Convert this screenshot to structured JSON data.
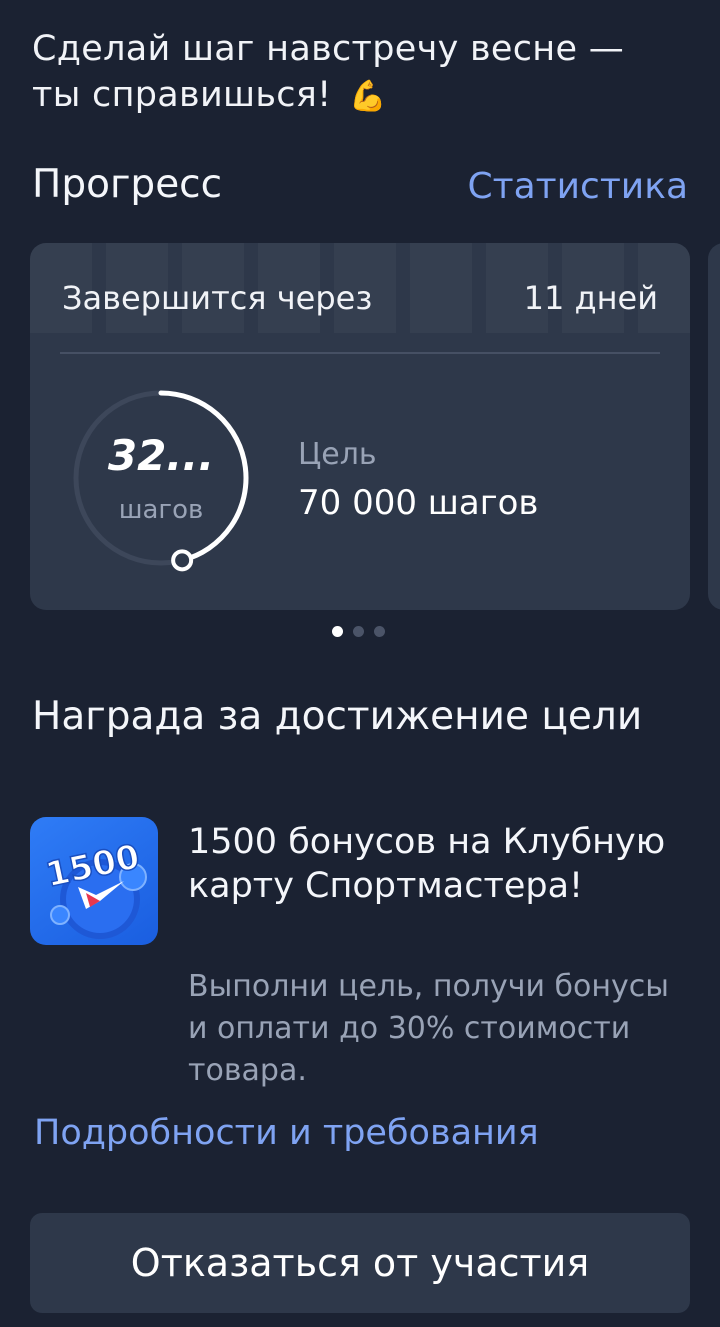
{
  "header": {
    "motivation_line1": "Сделай шаг навстречу весне —",
    "motivation_line2": "ты справишься!",
    "emoji": "💪"
  },
  "progress": {
    "title": "Прогресс",
    "stats_link": "Статистика",
    "card": {
      "ends_label": "Завершится через",
      "ends_value": "11 дней",
      "steps_value": "32...",
      "steps_unit": "шагов",
      "ring_fraction": 0.46,
      "goal_label": "Цель",
      "goal_value": "70 000 шагов"
    },
    "pager": {
      "count": 3,
      "active": 0
    }
  },
  "reward": {
    "title": "Награда за достижение цели",
    "image_text": "1500",
    "headline": "1500 бонусов на Клубную карту Спортмастера!",
    "description": "Выполни цель, получи бонусы и оплати до 30% стоимости товара.",
    "details_link": "Подробности и требования"
  },
  "actions": {
    "decline_label": "Отказаться от участия"
  },
  "colors": {
    "background": "#1b2232",
    "card": "#2e384a",
    "accent_link": "#7fa3f2",
    "muted_text": "#99a3b6",
    "reward_blue": "#2f7cf6"
  }
}
